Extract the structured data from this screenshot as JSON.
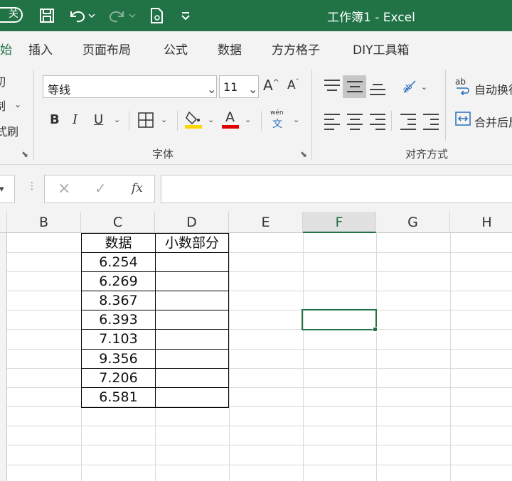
{
  "titlebar": {
    "autosave_label": "关",
    "title": "工作簿1  -  Excel"
  },
  "tabs": [
    "插入",
    "页面布局",
    "公式",
    "数据",
    "方方格子",
    "DIY工具箱"
  ],
  "ribbon": {
    "left_partial_items": [
      "切",
      "制",
      "式刷"
    ],
    "font_name": "等线",
    "font_size": "11",
    "bold": "B",
    "italic": "I",
    "underline": "U",
    "font_color_letter": "A",
    "phonetic_top": "wén",
    "phonetic_bottom": "文",
    "font_group_label": "字体",
    "wrap_text_label": "自动换行",
    "merge_label": "合并后居中",
    "alignment_group_label": "对齐方式",
    "abc_icon_text": "ab",
    "colors": {
      "fill_yellow": "#ffd700",
      "font_red": "#e00000"
    }
  },
  "formula_bar": {
    "cancel_icon": "×",
    "enter_icon": "✓",
    "fx_label": "fx",
    "value": ""
  },
  "sheet": {
    "columns": [
      "B",
      "C",
      "D",
      "E",
      "F",
      "G",
      "H"
    ],
    "active_column": "F",
    "headers": {
      "c": "数据",
      "d": "小数部分"
    },
    "rows": [
      {
        "c": "6.254",
        "d": ""
      },
      {
        "c": "6.269",
        "d": ""
      },
      {
        "c": "8.367",
        "d": ""
      },
      {
        "c": "6.393",
        "d": ""
      },
      {
        "c": "7.103",
        "d": ""
      },
      {
        "c": "9.356",
        "d": ""
      },
      {
        "c": "7.206",
        "d": ""
      },
      {
        "c": "6.581",
        "d": ""
      }
    ]
  },
  "accent_color": "#217346"
}
